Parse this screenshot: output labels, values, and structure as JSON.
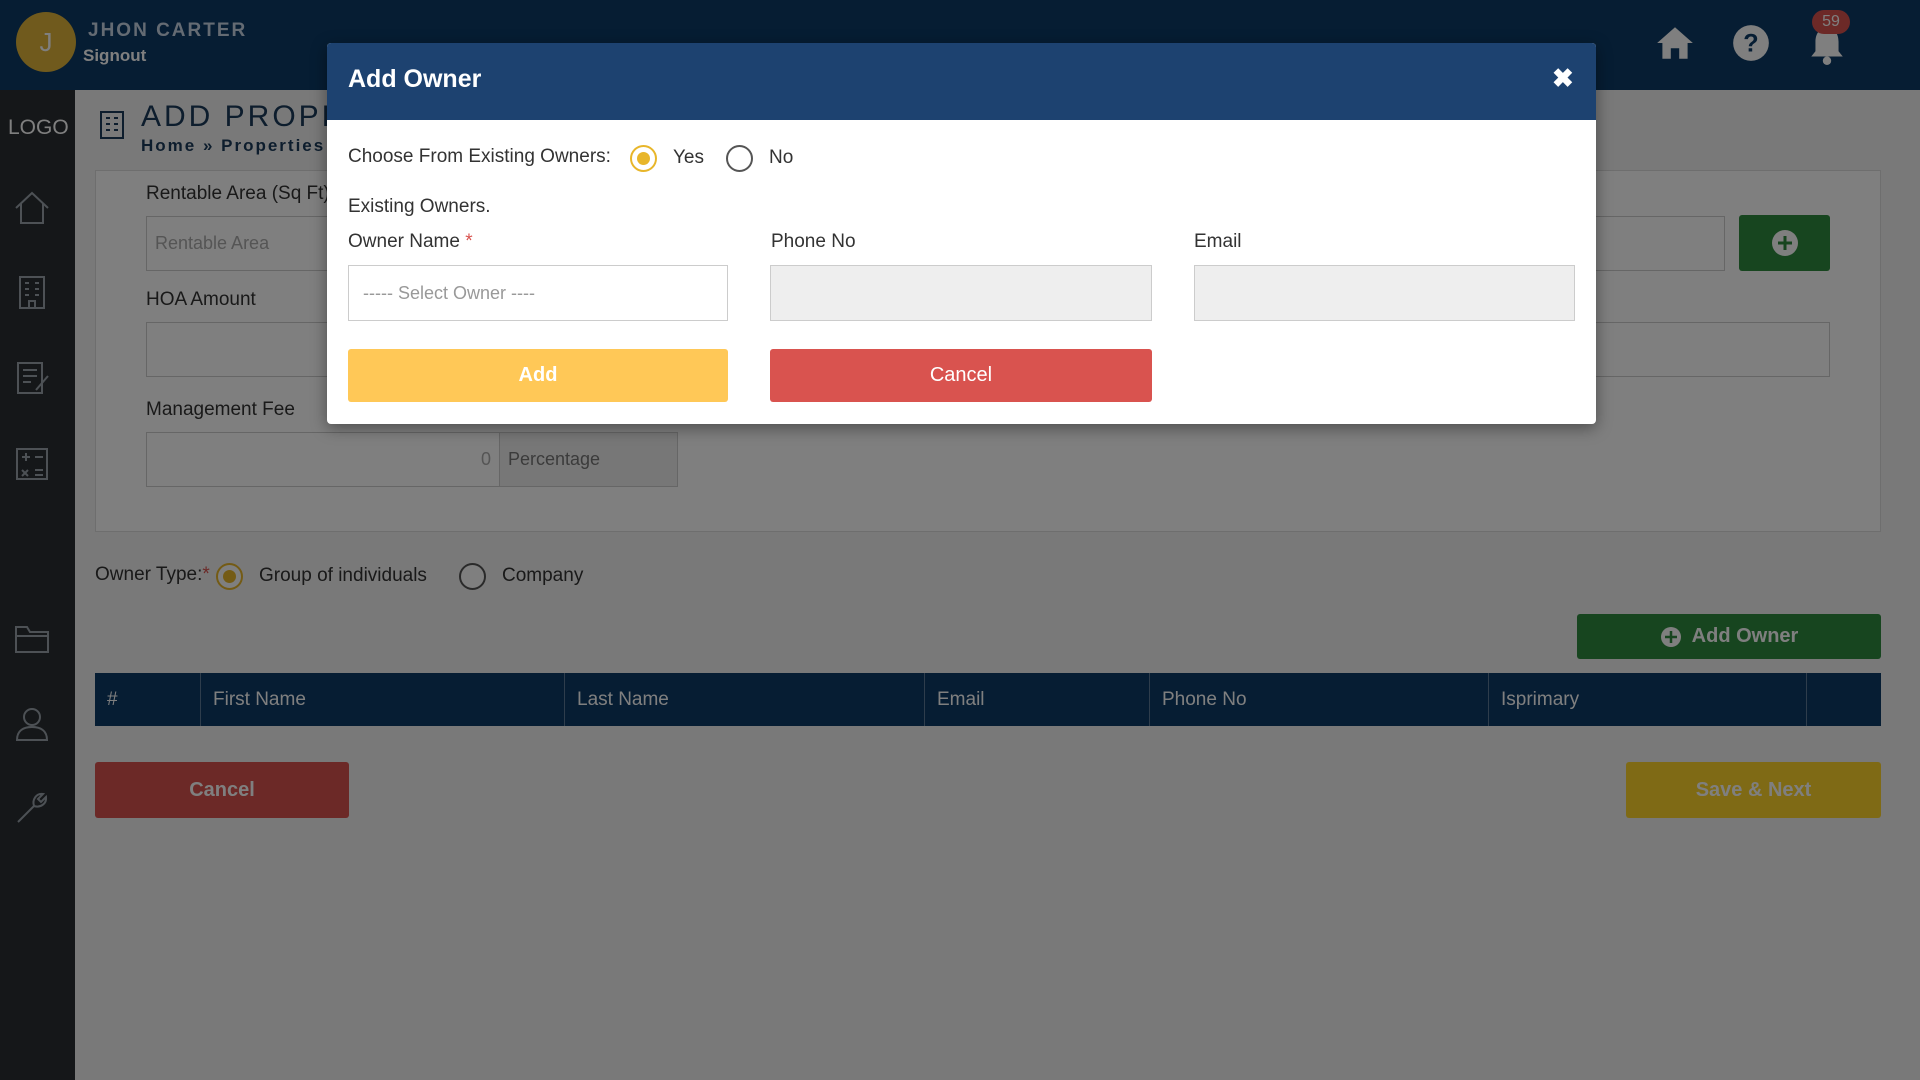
{
  "header": {
    "avatar_initial": "J",
    "user_name": "JHON CARTER",
    "signout": "Signout",
    "notification_count": "59",
    "icons": [
      "home-icon",
      "help-icon",
      "bell-icon"
    ]
  },
  "sidebar": {
    "logo": "LOGO",
    "icons": [
      "home-icon",
      "building-icon",
      "document-edit-icon",
      "calculator-icon",
      "folder-icon",
      "user-icon",
      "wrench-icon"
    ]
  },
  "page": {
    "title": "ADD PROPE",
    "breadcrumb": "Home » Properties",
    "fields": {
      "rentable_area_label": "Rentable Area (Sq Ft)",
      "rentable_area_placeholder": "Rentable Area",
      "hoa_amount_label": "HOA Amount",
      "management_fee_label": "Management Fee",
      "management_fee_value": "0",
      "management_fee_unit": "Percentage"
    },
    "owner_type": {
      "label": "Owner Type:",
      "required_mark": "*",
      "options": [
        "Group of individuals",
        "Company"
      ],
      "selected": "Group of individuals"
    },
    "add_owner_button": "Add Owner",
    "table": {
      "columns": [
        "#",
        "First Name",
        "Last Name",
        "Email",
        "Phone No",
        "Isprimary",
        ""
      ]
    },
    "cancel_button": "Cancel",
    "save_next_button": "Save & Next"
  },
  "modal": {
    "title": "Add Owner",
    "close": "✖",
    "choose_label": "Choose From Existing Owners:",
    "choose_options": [
      "Yes",
      "No"
    ],
    "choose_selected": "Yes",
    "existing_owners_label": "Existing Owners.",
    "owner_name_label": "Owner Name",
    "required_mark": "*",
    "owner_select_placeholder": "----- Select Owner ----",
    "phone_label": "Phone No",
    "email_label": "Email",
    "add_button": "Add",
    "cancel_button": "Cancel"
  },
  "colors": {
    "header_bg": "#0d3a66",
    "sidebar_bg": "#2a2f33",
    "modal_head_bg": "#1d4270",
    "add_yellow": "#ffc857",
    "cancel_red": "#d9534f",
    "add_owner_green": "#2e8b3e",
    "save_next_gold": "#c9a227"
  }
}
